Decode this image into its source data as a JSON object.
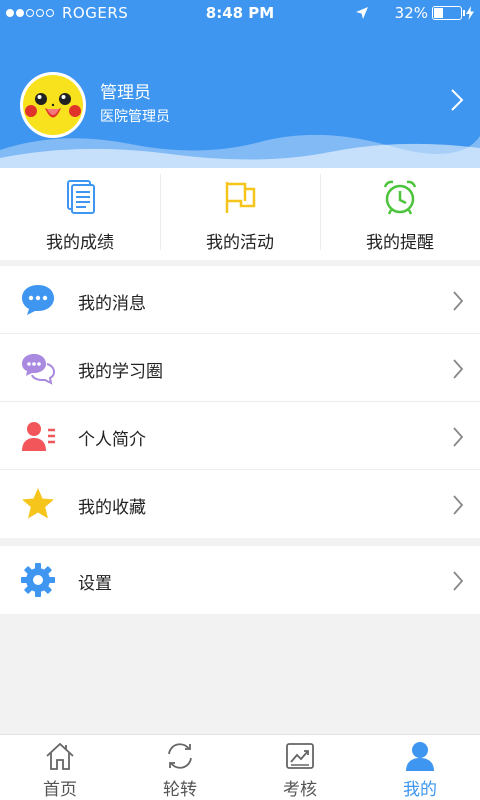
{
  "status_bar": {
    "carrier": "ROGERS",
    "time": "8:48 PM",
    "battery_percent": "32%",
    "battery_level": 0.32
  },
  "profile": {
    "name": "管理员",
    "role": "医院管理员"
  },
  "quick_actions": [
    {
      "label": "我的成绩",
      "icon": "document-icon",
      "color": "#3e96f0"
    },
    {
      "label": "我的活动",
      "icon": "flag-icon",
      "color": "#f5c51c"
    },
    {
      "label": "我的提醒",
      "icon": "alarm-clock-icon",
      "color": "#4cc43c"
    }
  ],
  "menu": [
    {
      "label": "我的消息",
      "icon": "chat-bubble-icon",
      "color": "#3e96f0"
    },
    {
      "label": "我的学习圈",
      "icon": "group-chat-icon",
      "color": "#a98ae0"
    },
    {
      "label": "个人简介",
      "icon": "person-card-icon",
      "color": "#f2565a"
    },
    {
      "label": "我的收藏",
      "icon": "star-icon",
      "color": "#f5c51c"
    }
  ],
  "settings": {
    "label": "设置",
    "icon": "gear-icon",
    "color": "#3e96f0"
  },
  "tabs": [
    {
      "label": "首页",
      "icon": "home-icon",
      "active": false
    },
    {
      "label": "轮转",
      "icon": "refresh-icon",
      "active": false
    },
    {
      "label": "考核",
      "icon": "chart-icon",
      "active": false
    },
    {
      "label": "我的",
      "icon": "user-icon",
      "active": true
    }
  ],
  "colors": {
    "accent": "#3e96f0",
    "background": "#f2f2f2"
  }
}
